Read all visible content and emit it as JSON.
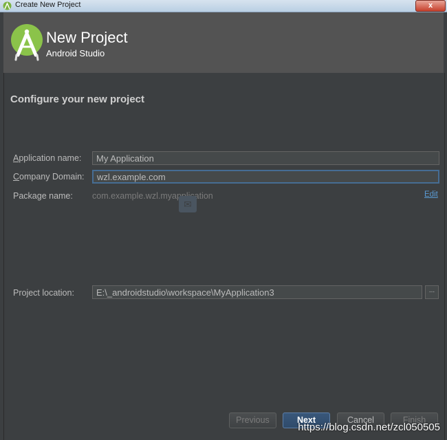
{
  "window": {
    "title": "Create New Project",
    "close_label": "x"
  },
  "header": {
    "title": "New Project",
    "subtitle": "Android Studio"
  },
  "form": {
    "section_title": "Configure your new project",
    "app_name": {
      "label_first": "A",
      "label_rest": "pplication name:",
      "value": "My Application"
    },
    "company_domain": {
      "label_first": "C",
      "label_rest": "ompany Domain:",
      "value": "wzl.example.com"
    },
    "package": {
      "label": "Package name:",
      "value": "com.example.wzl.myapplication",
      "edit_label": "Edit"
    },
    "location": {
      "label": "Project location:",
      "value": "E:\\_androidstudio\\workspace\\MyApplication3",
      "browse_label": "..."
    }
  },
  "buttons": {
    "previous": "Previous",
    "next": "Next",
    "cancel": "Cancel",
    "finish": "Finish"
  },
  "watermark": "https://blog.csdn.net/zcl050505",
  "colors": {
    "background": "#3c3f41",
    "header": "#535353",
    "android_green": "#8bc34a",
    "link": "#5a9bd4",
    "focus_border": "#466d94"
  }
}
